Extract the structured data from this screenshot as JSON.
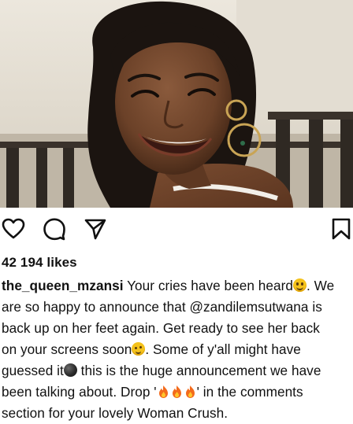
{
  "post": {
    "likes": "42 194 likes",
    "username": "the_queen_mzansi",
    "caption_lines": [
      {
        "before": "Your cries have been heard",
        "emoji": "smile",
        "after": ". We"
      },
      {
        "text": "are so happy to announce that @zandilemsutwana is"
      },
      {
        "text": "back up on her feet again. Get ready to see her back"
      },
      {
        "before": "on your screens soon",
        "emoji": "wink",
        "after": ". Some of y'all might have"
      },
      {
        "before": "guessed it",
        "emoji": "bomb",
        "after": " this is the huge announcement we have"
      },
      {
        "text": "been talking about. Drop '",
        "fires": 3,
        "after": "' in the comments"
      },
      {
        "text": "section for your lovely Woman Crush."
      }
    ]
  },
  "actions": {
    "like_icon": "heart-icon",
    "comment_icon": "comment-icon",
    "share_icon": "share-icon",
    "save_icon": "bookmark-icon"
  },
  "colors": {
    "text": "#111111",
    "background": "#ffffff",
    "emoji_face": "#f4c21c",
    "fire": "#f36b1c"
  }
}
